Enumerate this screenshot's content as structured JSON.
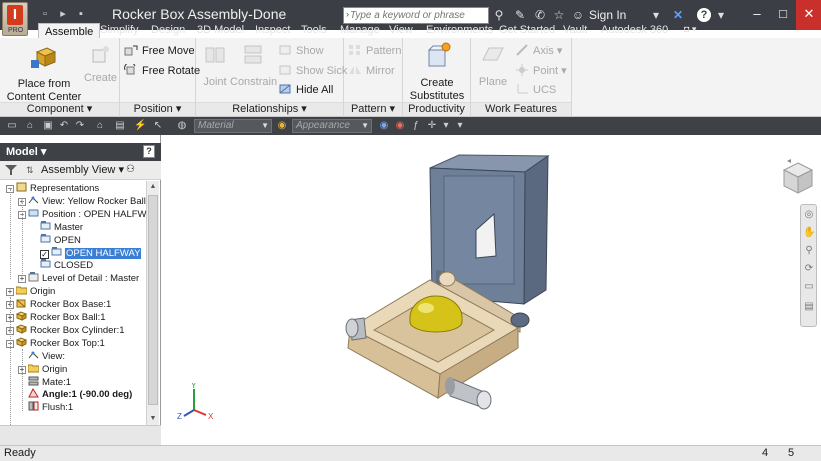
{
  "app": {
    "document_title": "Rocker Box Assembly-Done",
    "app_button_sub": "PRO",
    "search_placeholder": "Type a keyword or phrase",
    "sign_in": "Sign In"
  },
  "tabs": [
    "Assemble",
    "Simplify",
    "Design",
    "3D Model",
    "Inspect",
    "Tools",
    "Manage",
    "View",
    "Environments",
    "Get Started",
    "Vault",
    "Autodesk 360"
  ],
  "active_tab": "Assemble",
  "ribbon": {
    "component": {
      "title": "Component",
      "place_line1": "Place from",
      "place_line2": "Content Center",
      "create": "Create"
    },
    "position": {
      "title": "Position",
      "free_move": "Free Move",
      "free_rotate": "Free Rotate"
    },
    "relationships": {
      "title": "Relationships",
      "joint": "Joint",
      "constrain": "Constrain",
      "show": "Show",
      "show_sick": "Show Sick",
      "hide_all": "Hide All"
    },
    "pattern": {
      "title": "Pattern",
      "pattern": "Pattern",
      "mirror": "Mirror"
    },
    "productivity": {
      "title": "Productivity",
      "create_line1": "Create",
      "create_line2": "Substitutes"
    },
    "work_features": {
      "title": "Work Features",
      "plane": "Plane",
      "axis": "Axis",
      "point": "Point",
      "ucs": "UCS"
    }
  },
  "quickbar": {
    "material": "Material",
    "appearance": "Appearance"
  },
  "browser": {
    "title": "Model",
    "view_mode": "Assembly View",
    "help": "?",
    "tree": [
      {
        "label": "Representations",
        "level": 0,
        "expander": "-",
        "icon": "representations-icon",
        "bold": false
      },
      {
        "label": "View: Yellow Rocker Ball",
        "level": 1,
        "expander": "+",
        "icon": "view-rep-icon",
        "bold": false
      },
      {
        "label": "Position : OPEN HALFWAY",
        "level": 1,
        "expander": "-",
        "icon": "position-rep-icon",
        "bold": false
      },
      {
        "label": "Master",
        "level": 2,
        "expander": "",
        "icon": "position-icon",
        "bold": false
      },
      {
        "label": "OPEN",
        "level": 2,
        "expander": "",
        "icon": "position-icon",
        "bold": false
      },
      {
        "label": "OPEN HALFWAY",
        "level": 2,
        "expander": "",
        "icon": "position-icon",
        "bold": false,
        "selected": true,
        "checked": true
      },
      {
        "label": "CLOSED",
        "level": 2,
        "expander": "",
        "icon": "position-icon",
        "bold": false
      },
      {
        "label": "Level of Detail : Master",
        "level": 1,
        "expander": "+",
        "icon": "lod-icon",
        "bold": false
      },
      {
        "label": "Origin",
        "level": 0,
        "expander": "+",
        "icon": "folder-icon",
        "bold": false
      },
      {
        "label": "Rocker Box Base:1",
        "level": 0,
        "expander": "+",
        "icon": "grounded-part-icon",
        "bold": false
      },
      {
        "label": "Rocker Box Ball:1",
        "level": 0,
        "expander": "+",
        "icon": "part-icon",
        "bold": false
      },
      {
        "label": "Rocker Box Cylinder:1",
        "level": 0,
        "expander": "+",
        "icon": "part-icon",
        "bold": false
      },
      {
        "label": "Rocker Box Top:1",
        "level": 0,
        "expander": "-",
        "icon": "part-icon",
        "bold": false
      },
      {
        "label": "View:",
        "level": 1,
        "expander": "",
        "icon": "view-rep-icon",
        "bold": false
      },
      {
        "label": "Origin",
        "level": 1,
        "expander": "+",
        "icon": "folder-icon",
        "bold": false
      },
      {
        "label": "Mate:1",
        "level": 1,
        "expander": "",
        "icon": "mate-icon",
        "bold": false
      },
      {
        "label": "Angle:1 (-90.00 deg)",
        "level": 1,
        "expander": "",
        "icon": "angle-icon",
        "bold": true
      },
      {
        "label": "Flush:1",
        "level": 1,
        "expander": "",
        "icon": "flush-icon",
        "bold": false
      }
    ]
  },
  "triad": {
    "x": "X",
    "y": "Y",
    "z": "Z"
  },
  "status": {
    "text": "Ready",
    "count1": "4",
    "count2": "5"
  },
  "colors": {
    "title_bar": "#3b3e44",
    "ribbon": "#f3f3f3",
    "selection": "#3a7fd5",
    "top_plate": "#6e7f98",
    "base": "#e3cfae",
    "ball": "#d6c31a"
  }
}
